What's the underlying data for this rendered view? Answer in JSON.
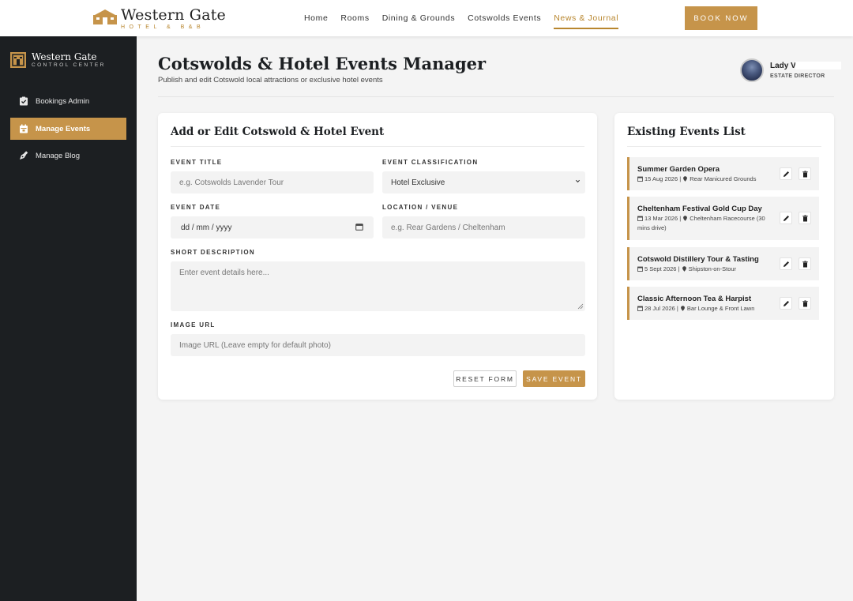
{
  "brand": {
    "name": "Western Gate",
    "tagline": "HOTEL & B&B"
  },
  "topnav": {
    "links": [
      "Home",
      "Rooms",
      "Dining & Grounds",
      "Cotswolds Events",
      "News & Journal"
    ],
    "active_link": "News & Journal",
    "book_button": "BOOK NOW"
  },
  "sidebar": {
    "brand_name": "Western Gate",
    "brand_sub": "CONTROL CENTER",
    "items": [
      {
        "label": "Bookings Admin",
        "icon": "clipboard-check-icon",
        "active": false
      },
      {
        "label": "Manage Events",
        "icon": "calendar-icon",
        "active": true
      },
      {
        "label": "Manage Blog",
        "icon": "pen-nib-icon",
        "active": false
      }
    ]
  },
  "header": {
    "title": "Cotswolds & Hotel Events Manager",
    "subtitle": "Publish and edit Cotswold local attractions or exclusive hotel events",
    "profile_name": "Lady V",
    "profile_role": "ESTATE DIRECTOR"
  },
  "form": {
    "title": "Add or Edit Cotswold & Hotel Event",
    "event_title_label": "EVENT TITLE",
    "event_title_placeholder": "e.g. Cotswolds Lavender Tour",
    "classification_label": "EVENT CLASSIFICATION",
    "classification_value": "Hotel Exclusive",
    "date_label": "EVENT DATE",
    "date_placeholder": "dd / mm / yyyy",
    "location_label": "LOCATION / VENUE",
    "location_placeholder": "e.g. Rear Gardens / Cheltenham",
    "description_label": "SHORT DESCRIPTION",
    "description_placeholder": "Enter event details here...",
    "image_label": "IMAGE URL",
    "image_placeholder": "Image URL (Leave empty for default photo)",
    "reset_label": "RESET FORM",
    "save_label": "SAVE EVENT"
  },
  "events_list": {
    "title": "Existing Events List",
    "items": [
      {
        "name": "Summer Garden Opera",
        "date": "15 Aug 2026",
        "location": "Rear Manicured Grounds"
      },
      {
        "name": "Cheltenham Festival Gold Cup Day",
        "date": "13 Mar 2026",
        "location": "Cheltenham Racecourse (30 mins drive)"
      },
      {
        "name": "Cotswold Distillery Tour & Tasting",
        "date": "5 Sept 2026",
        "location": "Shipston-on-Stour"
      },
      {
        "name": "Classic Afternoon Tea & Harpist",
        "date": "28 Jul 2026",
        "location": "Bar Lounge & Front Lawn"
      }
    ]
  },
  "colors": {
    "accent": "#c6944a",
    "sidebar_bg": "#1c1f22",
    "page_bg": "#f4f4f4"
  }
}
